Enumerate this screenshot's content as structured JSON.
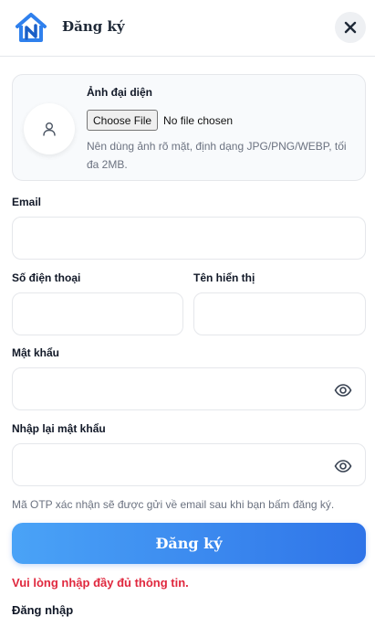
{
  "header": {
    "title": "Đăng ký",
    "logo_icon": "house-n-logo",
    "close_icon": "close-icon"
  },
  "avatar": {
    "label": "Ảnh đại diện",
    "file_button_label": "Choose File",
    "file_status": "No file chosen",
    "hint": "Nên dùng ảnh rõ mặt, định dạng JPG/PNG/WEBP, tối đa 2MB."
  },
  "form": {
    "email_label": "Email",
    "email_value": "",
    "phone_label": "Số điện thoại",
    "phone_value": "",
    "display_name_label": "Tên hiển thị",
    "display_name_value": "",
    "password_label": "Mật khẩu",
    "password_value": "",
    "confirm_password_label": "Nhập lại mật khẩu",
    "confirm_password_value": "",
    "otp_note": "Mã OTP xác nhận sẽ được gửi về email sau khi bạn bấm đăng ký.",
    "submit_label": "Đăng ký",
    "error_message": "Vui lòng nhập đầy đủ thông tin.",
    "login_link": "Đăng nhập"
  },
  "colors": {
    "accent_start": "#4aa3f7",
    "accent_end": "#2f74e8",
    "error": "#e0283e",
    "logo": "#2f80ed"
  }
}
